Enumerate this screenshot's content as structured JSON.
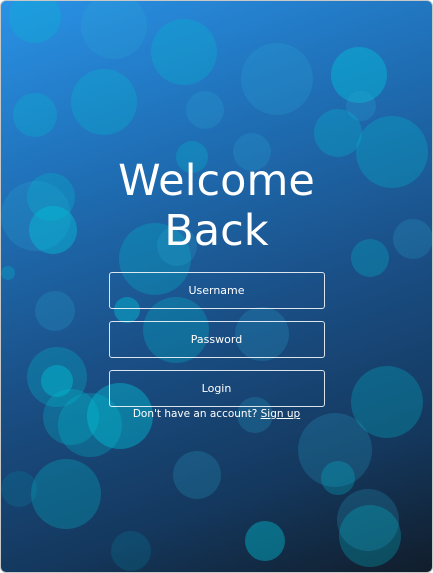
{
  "login": {
    "title": "Welcome Back",
    "username_placeholder": "Username",
    "password_placeholder": "Password",
    "login_label": "Login",
    "signup_prompt": "Don't have an account?",
    "signup_link": "Sign up"
  },
  "colors": {
    "gradient_top": "#2a92e6",
    "gradient_bottom": "#111d2b",
    "bokeh": "#00bed2",
    "text": "#ffffff"
  }
}
